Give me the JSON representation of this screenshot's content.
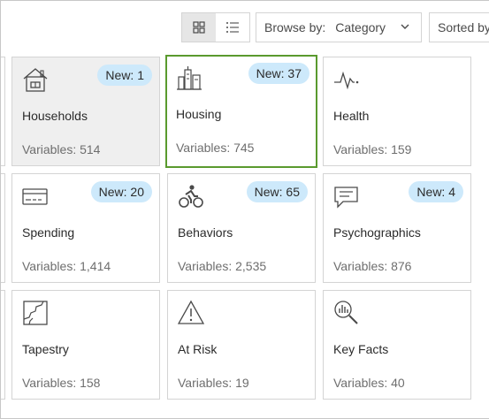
{
  "toolbar": {
    "grid_view_icon": "grid-icon",
    "list_view_icon": "list-icon",
    "browse_label": "Browse by:",
    "browse_value": "Category",
    "sort_label": "Sorted by"
  },
  "categories": [
    {
      "title": "Households",
      "variables": "Variables: 514",
      "badge": "New: 1",
      "icon": "house-icon",
      "state": "hovered"
    },
    {
      "title": "Housing",
      "variables": "Variables: 745",
      "badge": "New: 37",
      "icon": "buildings-icon",
      "state": "selected"
    },
    {
      "title": "Health",
      "variables": "Variables: 159",
      "badge": "",
      "icon": "heartbeat-icon",
      "state": "default"
    },
    {
      "title": "Spending",
      "variables": "Variables: 1,414",
      "badge": "New: 20",
      "icon": "credit-card-icon",
      "state": "default"
    },
    {
      "title": "Behaviors",
      "variables": "Variables: 2,535",
      "badge": "New: 65",
      "icon": "cyclist-icon",
      "state": "default"
    },
    {
      "title": "Psychographics",
      "variables": "Variables: 876",
      "badge": "New: 4",
      "icon": "speech-bubble-icon",
      "state": "default"
    },
    {
      "title": "Tapestry",
      "variables": "Variables: 158",
      "badge": "",
      "icon": "map-segment-icon",
      "state": "default"
    },
    {
      "title": "At Risk",
      "variables": "Variables: 19",
      "badge": "",
      "icon": "warning-icon",
      "state": "default"
    },
    {
      "title": "Key Facts",
      "variables": "Variables: 40",
      "badge": "",
      "icon": "magnify-chart-icon",
      "state": "default"
    }
  ],
  "colors": {
    "badge_bg": "#cde9fb",
    "selected_border": "#5a9a2e",
    "hover_bg": "#efefef"
  }
}
